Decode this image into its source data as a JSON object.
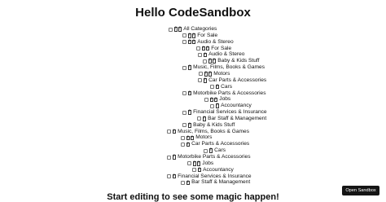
{
  "header": {
    "title": "Hello CodeSandbox"
  },
  "footer": {
    "subtitle": "Start editing to see some magic happen!"
  },
  "sandbox": {
    "open_label": "Open Sandbox"
  },
  "tree": {
    "items": [
      {
        "label": "All Categories",
        "glyphs": 2
      },
      {
        "label": "For Sale",
        "glyphs": 2
      },
      {
        "label": "Audio & Stereo",
        "glyphs": 2
      },
      {
        "label": "For Sale",
        "glyphs": 2
      },
      {
        "label": "Audio & Stereo",
        "glyphs": 1
      },
      {
        "label": "Baby & Kids Stuff",
        "glyphs": 2
      },
      {
        "label": "Music, Films, Books & Games",
        "glyphs": 1
      },
      {
        "label": "Motors",
        "glyphs": 2
      },
      {
        "label": "Car Parts & Accessories",
        "glyphs": 1
      },
      {
        "label": "Cars",
        "glyphs": 1
      },
      {
        "label": "Motorbike Parts & Accessories",
        "glyphs": 1
      },
      {
        "label": "Jobs",
        "glyphs": 2
      },
      {
        "label": "Accountancy",
        "glyphs": 1
      },
      {
        "label": "Financial Services & Insurance",
        "glyphs": 1
      },
      {
        "label": "Bar Staff & Management",
        "glyphs": 1
      },
      {
        "label": "Baby & Kids Stuff",
        "glyphs": 1
      },
      {
        "label": "Music, Films, Books & Games",
        "glyphs": 1
      },
      {
        "label": "Motors",
        "glyphs": 2
      },
      {
        "label": "Car Parts & Accessories",
        "glyphs": 1
      },
      {
        "label": "Cars",
        "glyphs": 1
      },
      {
        "label": "Motorbike Parts & Accessories",
        "glyphs": 1
      },
      {
        "label": "Jobs",
        "glyphs": 2
      },
      {
        "label": "Accountancy",
        "glyphs": 1
      },
      {
        "label": "Financial Services & Insurance",
        "glyphs": 1
      },
      {
        "label": "Bar Staff & Management",
        "glyphs": 1
      }
    ]
  }
}
